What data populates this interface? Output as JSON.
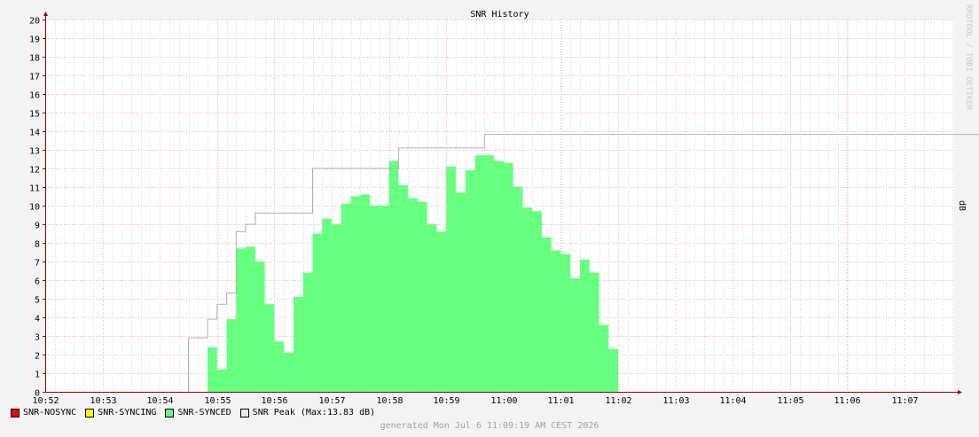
{
  "chart_data": {
    "type": "area",
    "title": "SNR History",
    "ylabel": "dB",
    "watermark": "RRDTOOL / TOBI OETIKER",
    "ylim": [
      0,
      20
    ],
    "y_ticks": [
      0,
      1,
      2,
      3,
      4,
      5,
      6,
      7,
      8,
      9,
      10,
      11,
      12,
      13,
      14,
      15,
      16,
      17,
      18,
      19,
      20
    ],
    "x_range_minutes": [
      0,
      16.5
    ],
    "x_tick_labels": [
      "10:52",
      "10:53",
      "10:54",
      "10:55",
      "10:56",
      "10:57",
      "10:58",
      "10:59",
      "11:00",
      "11:01",
      "11:02",
      "11:03",
      "11:04",
      "11:05",
      "11:06",
      "11:07"
    ],
    "step_minutes": 0.1667,
    "synced_start_minute": 2.833,
    "series": [
      {
        "name": "SNR-SYNCED",
        "color": "#66ff80",
        "values": [
          2.4,
          1.2,
          3.9,
          7.7,
          7.8,
          7.0,
          4.7,
          2.7,
          2.1,
          5.1,
          6.4,
          8.5,
          9.3,
          9.0,
          10.1,
          10.5,
          10.6,
          10.0,
          10.0,
          12.4,
          11.1,
          10.4,
          10.2,
          9.0,
          8.6,
          12.1,
          10.7,
          11.9,
          12.7,
          12.7,
          12.4,
          12.3,
          11.0,
          9.9,
          9.7,
          8.3,
          7.6,
          7.4,
          6.1,
          7.1,
          6.4,
          3.6,
          2.3
        ]
      },
      {
        "name": "SNR Peak",
        "color": "#b0b0b0",
        "points": [
          [
            2.5,
            2.9
          ],
          [
            2.833,
            3.9
          ],
          [
            3.0,
            4.7
          ],
          [
            3.167,
            5.3
          ],
          [
            3.333,
            8.6
          ],
          [
            3.5,
            9.0
          ],
          [
            3.667,
            9.6
          ],
          [
            4.667,
            9.6
          ],
          [
            4.667,
            12.0
          ],
          [
            6.167,
            12.0
          ],
          [
            6.167,
            13.1
          ],
          [
            7.667,
            13.1
          ],
          [
            7.667,
            13.83
          ],
          [
            16.3,
            13.83
          ]
        ]
      }
    ],
    "legend": [
      {
        "label": "SNR-NOSYNC",
        "color": "#ff0000"
      },
      {
        "label": "SNR-SYNCING",
        "color": "#ffff00"
      },
      {
        "label": "SNR-SYNCED",
        "color": "#66ff80"
      },
      {
        "label": "SNR Peak",
        "color": "#e8e8e8"
      }
    ],
    "peak_note": "(Max:13.83 dB)",
    "footer": "generated Mon Jul  6 11:09:19 AM CEST 2026",
    "grid": true,
    "legend_position": "bottom-left"
  },
  "colors": {
    "background": "#f3f3f3",
    "plot_background": "#ffffff",
    "major_grid": "#ffb0b0",
    "minor_grid": "#d8d8d8",
    "axis": "#a00000",
    "watermark": "#c8c8c8"
  }
}
